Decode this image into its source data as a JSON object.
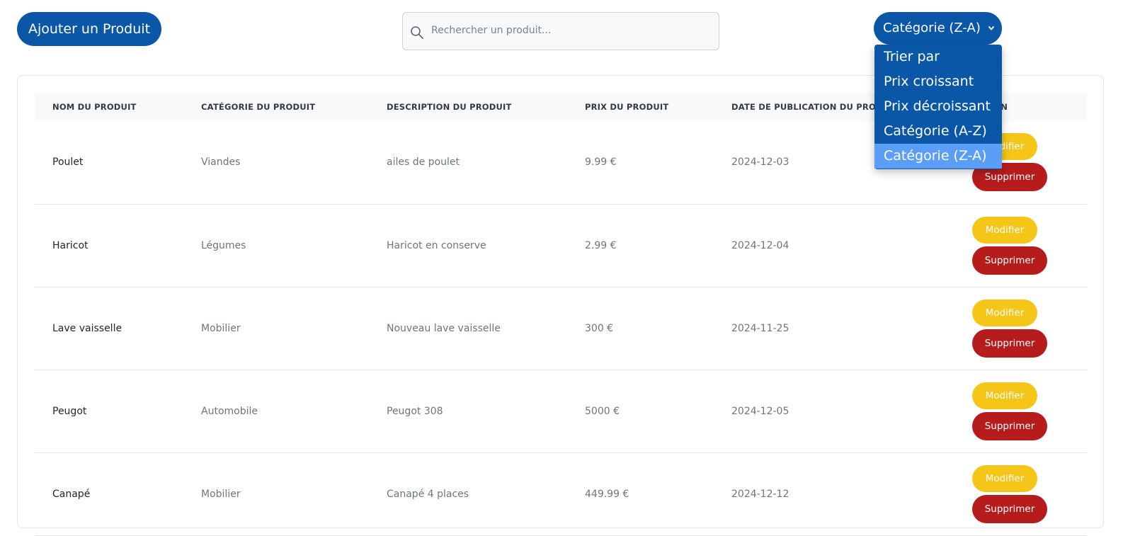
{
  "toolbar": {
    "add_label": "Ajouter un Produit",
    "search_placeholder": "Rechercher un produit...",
    "sort_selected": "Catégorie (Z-A)"
  },
  "sort_options": [
    "Trier par",
    "Prix croissant",
    "Prix décroissant",
    "Catégorie (A-Z)",
    "Catégorie (Z-A)"
  ],
  "table": {
    "headers": {
      "name": "NOM DU PRODUIT",
      "category": "CATÉGORIE DU PRODUIT",
      "description": "DESCRIPTION DU PRODUIT",
      "price": "PRIX DU PRODUIT",
      "date": "DATE DE PUBLICATION DU PRODUIT",
      "action": "ACTION"
    },
    "rows": [
      {
        "name": "Poulet",
        "category": "Viandes",
        "description": "ailes de poulet",
        "price": "9.99 €",
        "date": "2024-12-03"
      },
      {
        "name": "Haricot",
        "category": "Légumes",
        "description": "Haricot en conserve",
        "price": "2.99 €",
        "date": "2024-12-04"
      },
      {
        "name": "Lave vaisselle",
        "category": "Mobilier",
        "description": "Nouveau lave vaisselle",
        "price": "300 €",
        "date": "2024-11-25"
      },
      {
        "name": "Peugot",
        "category": "Automobile",
        "description": "Peugot 308",
        "price": "5000 €",
        "date": "2024-12-05"
      },
      {
        "name": "Canapé",
        "category": "Mobilier",
        "description": "Canapé 4 places",
        "price": "449.99 €",
        "date": "2024-12-12"
      }
    ],
    "edit_label": "Modifier",
    "delete_label": "Supprimer"
  },
  "colors": {
    "primary": "#0a57a8",
    "highlight": "#5a9ef8",
    "edit": "#f5c518",
    "delete": "#b71c1c"
  }
}
